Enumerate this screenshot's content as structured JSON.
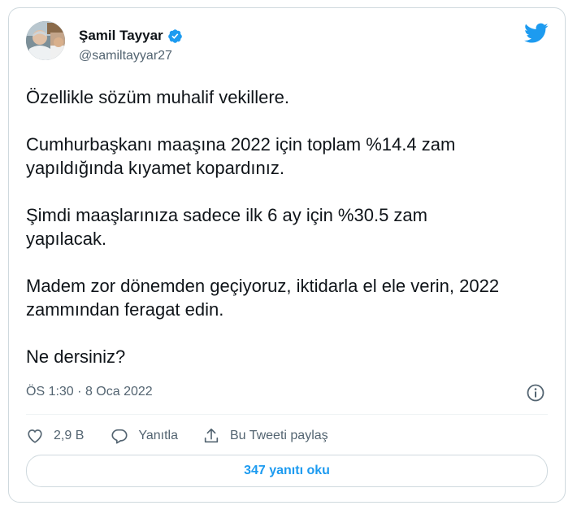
{
  "author": {
    "display_name": "Şamil Tayyar",
    "handle": "@samiltayyar27",
    "verified": true,
    "avatar_icon": "user-avatar-photo"
  },
  "brand": {
    "logo_icon": "twitter-bird-icon",
    "color": "#1d9bf0"
  },
  "tweet": {
    "paragraphs": [
      "Özellikle sözüm muhalif vekillere.",
      "Cumhurbaşkanı maaşına 2022 için toplam %14.4 zam yapıldığında kıyamet kopardınız.",
      "Şimdi maaşlarınıza sadece ilk 6 ay için %30.5 zam yapılacak.",
      "Madem zor dönemden geçiyoruz, iktidarla el ele verin, 2022 zammından feragat edin.",
      "Ne dersiniz?"
    ],
    "time": "ÖS 1:30",
    "separator": "·",
    "date": "8 Oca 2022"
  },
  "actions": {
    "like_count": "2,9 B",
    "reply_label": "Yanıtla",
    "share_label": "Bu Tweeti paylaş"
  },
  "replies_button": {
    "label": "347 yanıtı oku"
  },
  "colors": {
    "text": "#0f1419",
    "muted": "#536471",
    "border": "#cfd9de",
    "accent": "#1d9bf0"
  }
}
